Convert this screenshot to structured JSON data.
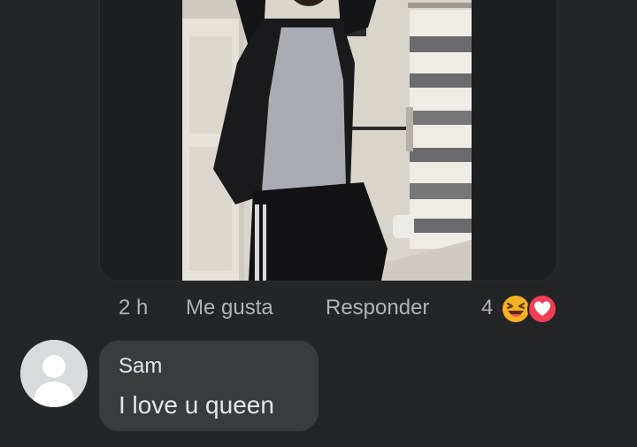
{
  "comment_actions": {
    "time": "2 h",
    "like_label": "Me gusta",
    "reply_label": "Responder",
    "reaction_count": "4",
    "reaction_icons": [
      "laughing-reaction-icon",
      "love-reaction-icon"
    ]
  },
  "reply_comment": {
    "author": "Sam",
    "text": "I love u queen"
  },
  "colors": {
    "background": "#242526",
    "bubble": "#3a3b3c",
    "muted_text": "#b0b3b8",
    "love_red": "#f33e58",
    "haha_yellow": "#f7b125"
  }
}
